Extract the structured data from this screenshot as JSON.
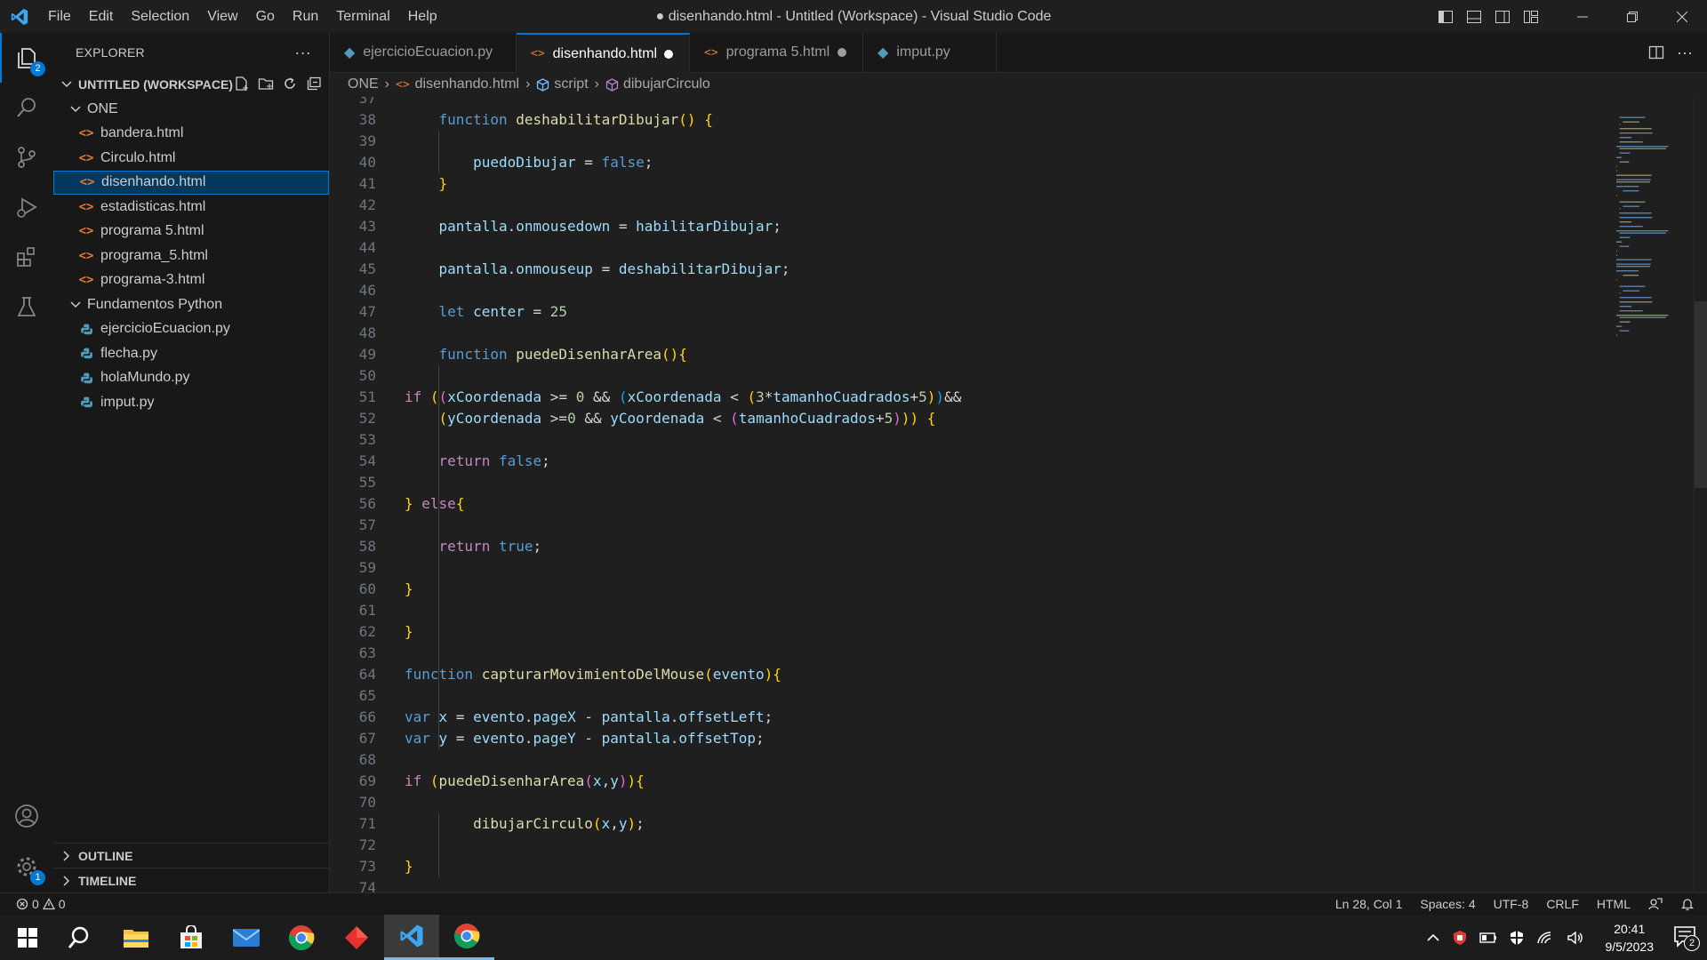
{
  "app": {
    "window_title": "● disenhando.html - Untitled (Workspace) - Visual Studio Code",
    "menu": [
      "File",
      "Edit",
      "Selection",
      "View",
      "Go",
      "Run",
      "Terminal",
      "Help"
    ]
  },
  "activity_bar": {
    "explorer_badge": "2",
    "settings_badge": "1"
  },
  "sidebar": {
    "title": "EXPLORER",
    "more": "···",
    "workspace": "UNTITLED (WORKSPACE)",
    "folders": [
      {
        "name": "ONE",
        "files": [
          "bandera.html",
          "Circulo.html",
          "disenhando.html",
          "estadisticas.html",
          "programa 5.html",
          "programa_5.html",
          "programa-3.html"
        ]
      },
      {
        "name": "Fundamentos Python",
        "files": [
          "ejercicioEcuacion.py",
          "flecha.py",
          "holaMundo.py",
          "imput.py"
        ]
      }
    ],
    "outline": "OUTLINE",
    "timeline": "TIMELINE"
  },
  "tabs": [
    {
      "label": "ejercicioEcuacion.py",
      "type": "py",
      "active": false,
      "dirty": false
    },
    {
      "label": "disenhando.html",
      "type": "html",
      "active": true,
      "dirty": true
    },
    {
      "label": "programa 5.html",
      "type": "html",
      "active": false,
      "dirty": true
    },
    {
      "label": "imput.py",
      "type": "py",
      "active": false,
      "dirty": false
    }
  ],
  "breadcrumb": {
    "folder": "ONE",
    "file": "disenhando.html",
    "section": "script",
    "symbol": "dibujarCirculo"
  },
  "code": {
    "first_line": 37,
    "lines": [
      "",
      "    function deshabilitarDibujar() {",
      "",
      "        puedoDibujar = false;",
      "    }",
      "",
      "    pantalla.onmousedown = habilitarDibujar;",
      "",
      "    pantalla.onmouseup = deshabilitarDibujar;",
      "",
      "    let center = 25",
      "",
      "    function puedeDisenharArea(){",
      "",
      "if ((xCoordenada >= 0 && (xCoordenada < (3*tamanhoCuadrados+5))&&",
      "    (yCoordenada >=0 && yCoordenada < (tamanhoCuadrados+5))) {",
      "",
      "    return false;",
      "",
      "} else{",
      "",
      "    return true;",
      "",
      "}",
      "",
      "}",
      "",
      "function capturarMovimientoDelMouse(evento){",
      "",
      "var x = evento.pageX - pantalla.offsetLeft;",
      "var y = evento.pageY - pantalla.offsetTop;",
      "",
      "if (puedeDisenharArea(x,y)){",
      "",
      "        dibujarCirculo(x,y);",
      "",
      "}",
      ""
    ]
  },
  "status": {
    "errors": "0",
    "warnings": "0",
    "position": "Ln 28, Col 1",
    "spaces": "Spaces: 4",
    "encoding": "UTF-8",
    "eol": "CRLF",
    "language": "HTML"
  },
  "taskbar": {
    "time": "20:41",
    "date": "9/5/2023",
    "notifications": "2"
  }
}
